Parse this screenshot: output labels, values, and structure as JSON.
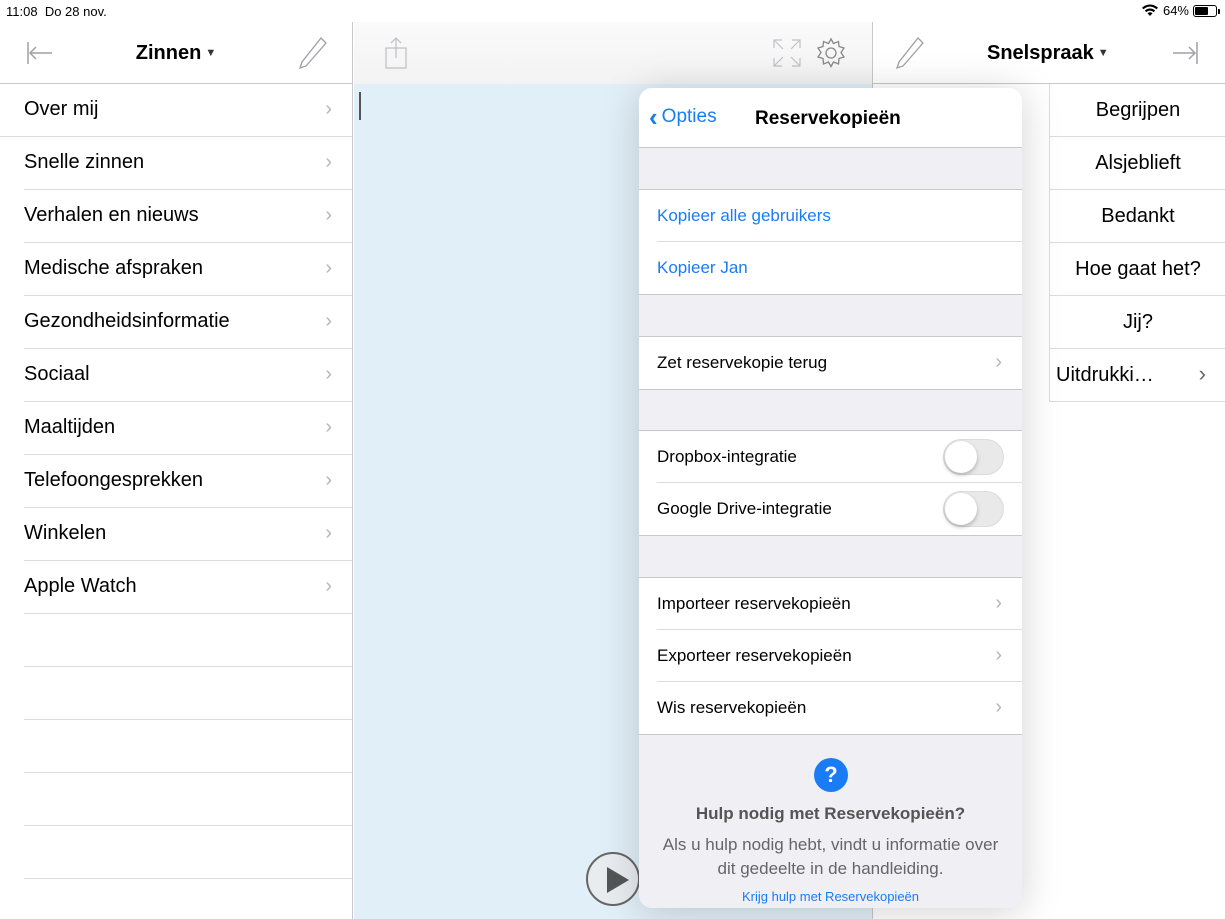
{
  "status": {
    "time": "11:08",
    "date": "Do 28 nov.",
    "battery": "64%",
    "battery_level": 0.64
  },
  "left": {
    "title": "Zinnen",
    "items": [
      "Over mij",
      "Snelle zinnen",
      "Verhalen en nieuws",
      "Medische afspraken",
      "Gezondheidsinformatie",
      "Sociaal",
      "Maaltijden",
      "Telefoongesprekken",
      "Winkelen",
      "Apple Watch"
    ]
  },
  "right": {
    "title": "Snelspraak",
    "items": [
      "Begrijpen",
      "Alsjeblieft",
      "Bedankt",
      "Hoe gaat het?",
      "Jij?"
    ],
    "more": "Uitdrukki…"
  },
  "popover": {
    "back": "Opties",
    "title": "Reservekopieën",
    "copy_all": "Kopieer alle gebruikers",
    "copy_user": "Kopieer Jan",
    "restore": "Zet reservekopie terug",
    "dropbox": "Dropbox-integratie",
    "gdrive": "Google Drive-integratie",
    "import": "Importeer reservekopieën",
    "export": "Exporteer reservekopieën",
    "wipe": "Wis reservekopieën",
    "help_title": "Hulp nodig met Reservekopieën?",
    "help_body": "Als u hulp nodig hebt, vindt u informatie over dit gedeelte in de handleiding.",
    "help_link": "Krijg hulp met Reservekopieën",
    "dropbox_on": false,
    "gdrive_on": false
  },
  "icons": {
    "collapse_left": "arrow-left-bar-icon",
    "edit": "pencil-icon",
    "share": "share-icon",
    "fullscreen": "expand-icon",
    "settings": "gear-icon",
    "collapse_right": "arrow-right-bar-icon",
    "wifi": "wifi-icon",
    "play": "play-icon",
    "help": "question-icon"
  },
  "colors": {
    "accent": "#1a7cf5",
    "text_area": "#e1eff8"
  }
}
